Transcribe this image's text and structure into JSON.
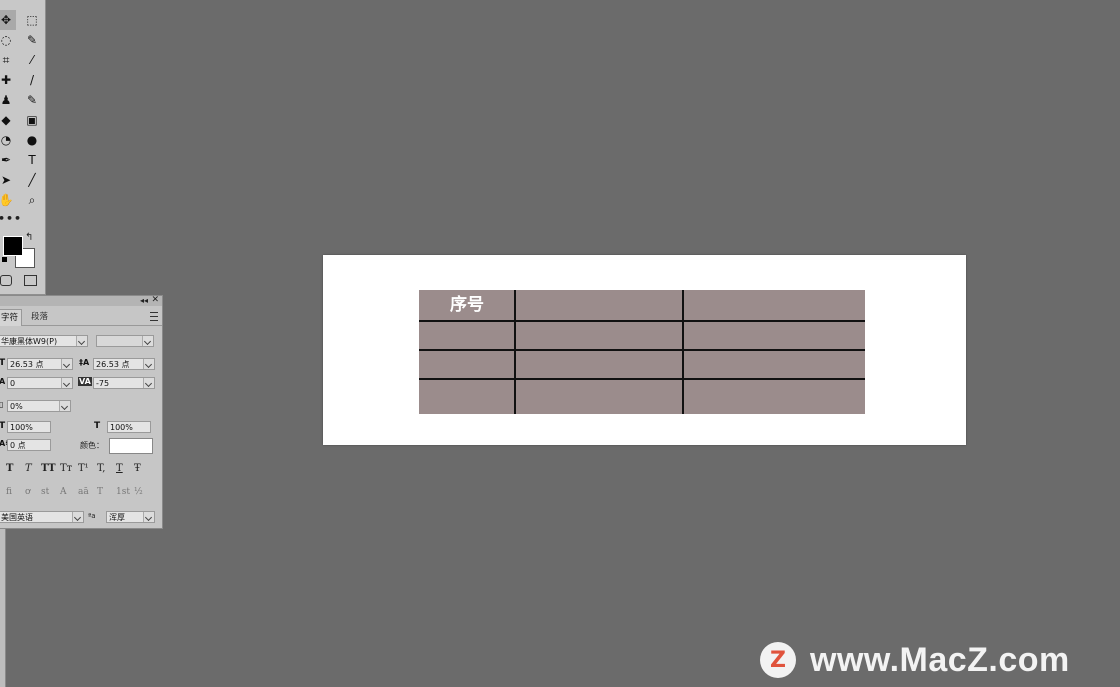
{
  "toolbar": {
    "tools": [
      [
        "move-icon",
        "marquee-icon"
      ],
      [
        "lasso-icon",
        "quick-select-icon"
      ],
      [
        "crop-icon",
        "eyedropper-icon"
      ],
      [
        "healing-icon",
        "brush-icon"
      ],
      [
        "stamp-icon",
        "history-brush-icon"
      ],
      [
        "eraser-icon",
        "gradient-icon"
      ],
      [
        "blur-icon",
        "dodge-icon"
      ],
      [
        "pen-icon",
        "type-icon"
      ],
      [
        "path-select-icon",
        "line-icon"
      ],
      [
        "hand-icon",
        "zoom-icon"
      ]
    ],
    "more": "•••",
    "foreground_color": "#000000",
    "background_color": "#ffffff"
  },
  "char_panel": {
    "tab_active": "字符",
    "tab_inactive": "段落",
    "font_family": "华康黑体W9(P)",
    "font_style": "",
    "font_size": "26.53 点",
    "leading": "26.53 点",
    "kerning": "0",
    "tracking": "-75",
    "tsume": "0%",
    "vertical_scale": "100%",
    "horizontal_scale": "100%",
    "baseline_shift": "0 点",
    "color_label": "颜色：",
    "language": "美国英语",
    "antialias": "浑厚",
    "style_buttons": [
      "T",
      "T",
      "TT",
      "Tт",
      "T¹",
      "T,",
      "T",
      "Ŧ"
    ],
    "opentype_buttons": [
      "fi",
      "ơ",
      "st",
      "A",
      "aā",
      "T",
      "1st",
      "½"
    ]
  },
  "document": {
    "table": {
      "header_cell": "序号",
      "fill_color": "#9b8c8c",
      "rows": 4,
      "cols": 3
    }
  },
  "watermark": {
    "logo_letter": "Z",
    "text": "www.MacZ.com"
  }
}
